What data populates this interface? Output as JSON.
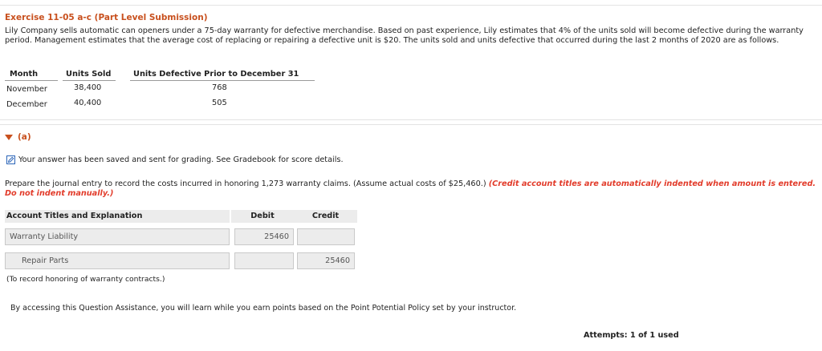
{
  "exercise": {
    "title": "Exercise 11-05 a-c (Part Level Submission)",
    "intro": "Lily Company sells automatic can openers under a 75-day warranty for defective merchandise. Based on past experience, Lily estimates that 4% of the units sold will become defective during the warranty period. Management estimates that the average cost of replacing or repairing a defective unit is $20. The units sold and units defective that occurred during the last 2 months of 2020 are as follows."
  },
  "data_table": {
    "headers": [
      "Month",
      "Units Sold",
      "Units Defective Prior to December 31"
    ],
    "rows": [
      {
        "month": "November",
        "units_sold": "38,400",
        "units_defective": "768"
      },
      {
        "month": "December",
        "units_sold": "40,400",
        "units_defective": "505"
      }
    ]
  },
  "part_a": {
    "label": "(a)",
    "saved_message": "Your answer has been saved and sent for grading. See Gradebook for score details.",
    "instruction": "Prepare the journal entry to record the costs incurred in honoring 1,273 warranty claims. (Assume actual costs of $25,460.)",
    "instruction_note": "(Credit account titles are automatically indented when amount is entered. Do not indent manually.)",
    "journal": {
      "headers": {
        "account": "Account Titles and Explanation",
        "debit": "Debit",
        "credit": "Credit"
      },
      "rows": [
        {
          "account": "Warranty Liability",
          "debit": "25460",
          "credit": ""
        },
        {
          "account": "Repair Parts",
          "debit": "",
          "credit": "25460"
        }
      ],
      "explanation": "(To record honoring of warranty contracts.)"
    }
  },
  "footer": {
    "assistance": "By accessing this Question Assistance, you will learn while you earn points based on the Point Potential Policy set by your instructor.",
    "attempts": "Attempts: 1 of 1 used"
  },
  "colors": {
    "accent": "#c8501e",
    "alert": "#e23b2a",
    "field_bg": "#ececec"
  },
  "icons": {
    "expand": "triangle-down-icon",
    "saved": "pencil-icon"
  }
}
